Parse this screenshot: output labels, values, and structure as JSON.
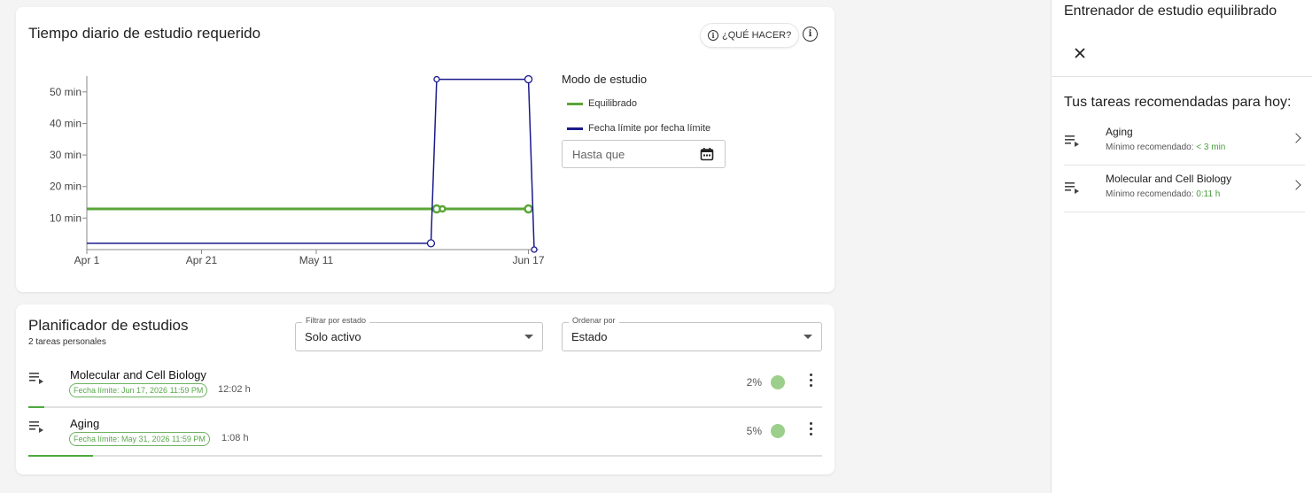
{
  "chart_card": {
    "title": "Tiempo diario de estudio requerido",
    "what_to_do_label": "¿QUÉ HACER?",
    "legend_title": "Modo de estudio",
    "legend": [
      {
        "label": "Equilibrado",
        "color": "#5aa637"
      },
      {
        "label": "Fecha límite por fecha límite",
        "color": "#1a1a8c"
      }
    ],
    "date_input_placeholder": "Hasta que"
  },
  "chart_data": {
    "type": "line",
    "title": "Tiempo diario de estudio requerido",
    "xlabel": "",
    "ylabel": "",
    "x_axis_type": "date",
    "x_ticks": [
      "Apr 1",
      "Apr 21",
      "May 11",
      "Jun 17"
    ],
    "y_ticks": [
      "10 min",
      "20 min",
      "30 min",
      "40 min",
      "50 min"
    ],
    "ylim": [
      0,
      55
    ],
    "xlim": [
      "Apr 1",
      "Jun 18"
    ],
    "series": [
      {
        "name": "Equilibrado",
        "color": "#5aa637",
        "points": [
          {
            "x": "Apr 1",
            "y": 12.9
          },
          {
            "x": "Jun 1",
            "y": 12.9,
            "marker": true
          },
          {
            "x": "Jun 2",
            "y": 12.9,
            "marker": true
          },
          {
            "x": "Jun 17",
            "y": 12.9,
            "marker": true
          }
        ]
      },
      {
        "name": "Fecha límite por fecha límite",
        "color": "#1a1a8c",
        "points": [
          {
            "x": "Apr 1",
            "y": 2
          },
          {
            "x": "May 31",
            "y": 2,
            "marker": true
          },
          {
            "x": "Jun 1",
            "y": 54,
            "marker": true
          },
          {
            "x": "Jun 17",
            "y": 54,
            "marker": true
          },
          {
            "x": "Jun 18",
            "y": 0,
            "marker": true
          }
        ]
      }
    ]
  },
  "planner": {
    "title": "Planificador de estudios",
    "subtitle": "2 tareas personales",
    "filter_label": "Filtrar por estado",
    "filter_value": "Solo activo",
    "sort_label": "Ordenar por",
    "sort_value": "Estado",
    "tasks": [
      {
        "name": "Molecular and Cell Biology",
        "deadline": "Fecha límite: Jun 17, 2026 11:59 PM",
        "duration": "12:02 h",
        "percent_label": "2%",
        "progress": 0.02
      },
      {
        "name": "Aging",
        "deadline": "Fecha límite: May 31, 2026 11:59 PM",
        "duration": "1:08 h",
        "percent_label": "5%",
        "progress": 0.05
      }
    ]
  },
  "side_panel": {
    "title": "Entrenador de estudio equilibrado",
    "heading": "Tus tareas recomendadas para hoy:",
    "items": [
      {
        "name": "Aging",
        "min_prefix": "Mínimo recomendado: ",
        "min_value": "< 3 min"
      },
      {
        "name": "Molecular and Cell Biology",
        "min_prefix": "Mínimo recomendado: ",
        "min_value": "0:11 h"
      }
    ]
  }
}
